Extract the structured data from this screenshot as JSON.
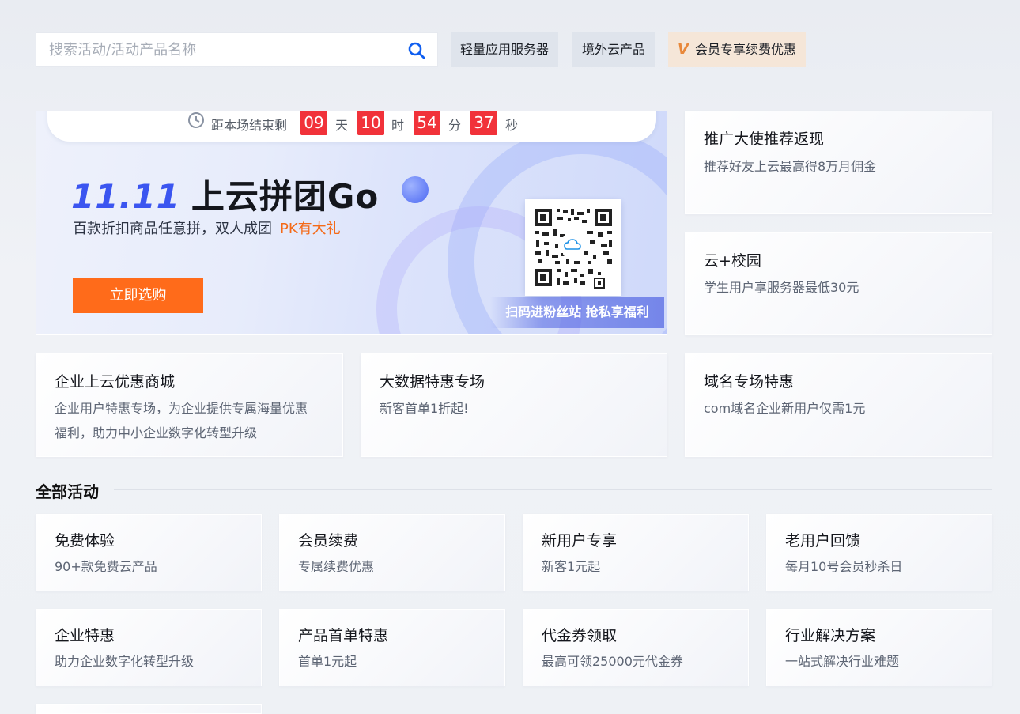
{
  "search": {
    "placeholder": "搜索活动/活动产品名称"
  },
  "quick_tags": [
    {
      "label": "轻量应用服务器"
    },
    {
      "label": "境外云产品"
    },
    {
      "label": "会员专享续费优惠",
      "badge": "V"
    }
  ],
  "banner": {
    "countdown_label": "距本场结束剩",
    "days": "09",
    "days_unit": "天",
    "hours": "10",
    "hours_unit": "时",
    "minutes": "54",
    "minutes_unit": "分",
    "seconds": "37",
    "seconds_unit": "秒",
    "title_num": "11.11",
    "title": "上云拼团Go",
    "subtitle": "百款折扣商品任意拼，双人成团",
    "subtitle_highlight": "PK有大礼",
    "cta": "立即选购",
    "qr_caption": "扫码进粉丝站 抢私享福利",
    "colors": {
      "accent": "#3b55f0",
      "cta": "#ff6b1a",
      "countdown": "#f1323a"
    }
  },
  "side_cards": [
    {
      "title": "推广大使推荐返现",
      "desc": "推荐好友上云最高得8万月佣金"
    },
    {
      "title": "云+校园",
      "desc": "学生用户享服务器最低30元"
    }
  ],
  "promo_cards": [
    {
      "title": "企业上云优惠商城",
      "desc": "企业用户特惠专场，为企业提供专属海量优惠",
      "desc2": "福利，助力中小企业数字化转型升级"
    },
    {
      "title": "大数据特惠专场",
      "desc": "新客首单1折起!"
    },
    {
      "title": "域名专场特惠",
      "desc": "com域名企业新用户仅需1元"
    }
  ],
  "all_activities": {
    "title": "全部活动",
    "items": [
      {
        "title": "免费体验",
        "desc": "90+款免费云产品"
      },
      {
        "title": "会员续费",
        "desc": "专属续费优惠"
      },
      {
        "title": "新用户专享",
        "desc": "新客1元起"
      },
      {
        "title": "老用户回馈",
        "desc": "每月10号会员秒杀日"
      },
      {
        "title": "企业特惠",
        "desc": "助力企业数字化转型升级"
      },
      {
        "title": "产品首单特惠",
        "desc": "首单1元起"
      },
      {
        "title": "代金券领取",
        "desc": "最高可领25000元代金券"
      },
      {
        "title": "行业解决方案",
        "desc": "一站式解决行业难题"
      }
    ]
  }
}
